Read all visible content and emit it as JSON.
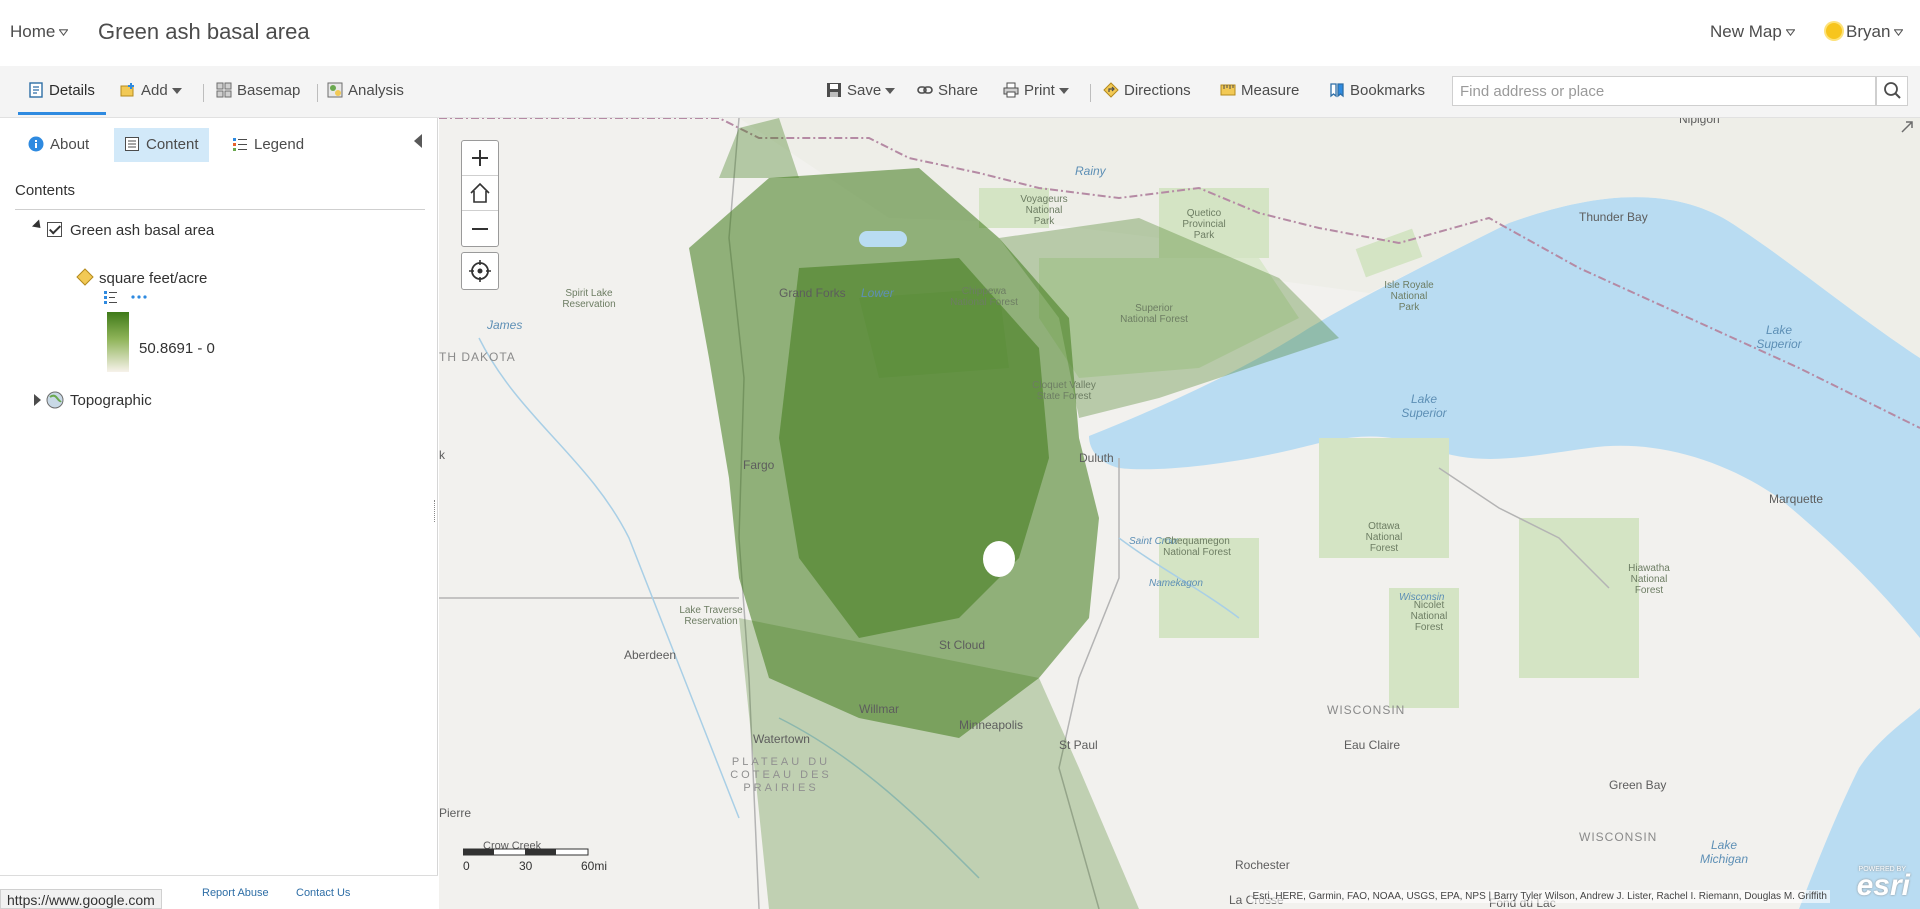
{
  "header": {
    "home_label": "Home",
    "map_title": "Green ash basal area",
    "new_map_label": "New Map",
    "user_name": "Bryan"
  },
  "toolbar": {
    "details": "Details",
    "add": "Add",
    "basemap": "Basemap",
    "analysis": "Analysis",
    "save": "Save",
    "share": "Share",
    "print": "Print",
    "directions": "Directions",
    "measure": "Measure",
    "bookmarks": "Bookmarks",
    "search_placeholder": "Find address or place"
  },
  "panel": {
    "tabs": [
      "About",
      "Content",
      "Legend"
    ],
    "active_tab": "Content",
    "contents_label": "Contents",
    "layers": [
      {
        "name": "Green ash basal area",
        "checked": true,
        "expanded": true,
        "legend_field": "square feet/acre",
        "legend_range": "50.8691 - 0"
      },
      {
        "name": "Topographic",
        "expanded": false
      }
    ],
    "footer_links": [
      "Report Abuse",
      "Contact Us"
    ]
  },
  "status_bar": {
    "url": "https://www.google.com"
  },
  "map": {
    "labels": {
      "nipigon": "Nipigon",
      "rainy": "Rainy",
      "voyageurs": "Voyageurs National Park",
      "quetico": "Quetico Provincial Park",
      "thunder_bay": "Thunder Bay",
      "isle_royale": "Isle Royale National Park",
      "lake_superior_1": "Lake Superior",
      "lake_superior_2": "Lake Superior",
      "spirit_lake": "Spirit Lake Reservation",
      "grand_forks": "Grand Forks",
      "lower": "Lower",
      "chippewa": "Chippewa National Forest",
      "superior_nf": "Superior National Forest",
      "james": "James",
      "north_dakota": "TH DAKOTA",
      "fargo": "Fargo",
      "cloquet": "Cloquet Valley State Forest",
      "duluth": "Duluth",
      "marquette": "Marquette",
      "k": "k",
      "saint_croix": "Saint Croix",
      "chequamegon": "Chequamegon National Forest",
      "ottawa_nf": "Ottawa National Forest",
      "namekagon": "Namekagon",
      "wisconsin_river": "Wisconsin",
      "hiawatha": "Hiawatha National Forest",
      "nicolet": "Nicolet National Forest",
      "lake_traverse": "Lake Traverse Reservation",
      "aberdeen": "Aberdeen",
      "st_cloud": "St Cloud",
      "willmar": "Willmar",
      "wisconsin_state": "WISCONSIN",
      "eau_claire": "Eau Claire",
      "watertown": "Watertown",
      "plateau": "PLATEAU DU COTEAU DES PRAIRIES",
      "minneapolis": "Minneapolis",
      "st_paul": "St Paul",
      "green_bay": "Green Bay",
      "pierre": "Pierre",
      "wisconsin_state_2": "WISCONSIN",
      "crow_creek": "Crow Creek",
      "rochester": "Rochester",
      "lake_michigan": "Lake Michigan",
      "la_crosse": "La Crosse",
      "fond_du_lac": "Fond du Lac"
    },
    "scale": {
      "labels": [
        "0",
        "30",
        "60mi"
      ]
    },
    "attribution": "Esri, HERE, Garmin, FAO, NOAA, USGS, EPA, NPS | Barry Tyler Wilson, Andrew J. Lister, Rachel I. Riemann, Douglas M. Griffith",
    "logo_text": "esri",
    "logo_powered": "POWERED BY"
  },
  "colors": {
    "accent": "#2e8ae0",
    "data_green": "#3f7a19",
    "water": "#b9dcf2",
    "park_green": "#d4e4c4",
    "land": "#f2f1ee"
  },
  "icons": {
    "home_caret": "chevron-down-icon",
    "details": "details-icon",
    "add": "add-icon",
    "basemap": "basemap-icon",
    "analysis": "analysis-icon",
    "save": "save-icon",
    "share": "share-icon",
    "print": "print-icon",
    "directions": "directions-icon",
    "measure": "measure-icon",
    "bookmarks": "bookmarks-icon",
    "search": "search-icon"
  }
}
